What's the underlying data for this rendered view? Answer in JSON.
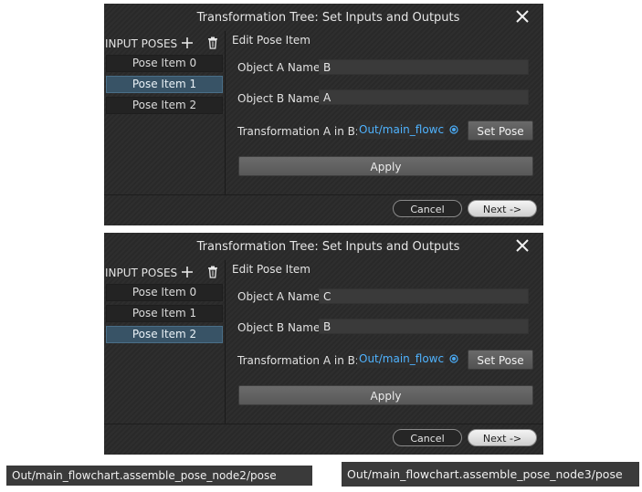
{
  "dialogs": [
    {
      "title": "Transformation Tree: Set Inputs and Outputs",
      "panel_label": "INPUT POSES",
      "pose_items": [
        {
          "label": "Pose Item 0",
          "selected": false
        },
        {
          "label": "Pose Item 1",
          "selected": true
        },
        {
          "label": "Pose Item 2",
          "selected": false
        }
      ],
      "editor_title": "Edit Pose Item",
      "object_a_label": "Object A Name:",
      "object_a_value": "B",
      "object_b_label": "Object B Name:",
      "object_b_value": "A",
      "transform_label": "Transformation A in B:",
      "transform_value": "Out/main_flowchart.assemble_pose_node2/pose",
      "set_pose_label": "Set Pose",
      "apply_label": "Apply",
      "cancel_label": "Cancel",
      "next_label": "Next ->"
    },
    {
      "title": "Transformation Tree: Set Inputs and Outputs",
      "panel_label": "INPUT POSES",
      "pose_items": [
        {
          "label": "Pose Item 0",
          "selected": false
        },
        {
          "label": "Pose Item 1",
          "selected": false
        },
        {
          "label": "Pose Item 2",
          "selected": true
        }
      ],
      "editor_title": "Edit Pose Item",
      "object_a_label": "Object A Name:",
      "object_a_value": "C",
      "object_b_label": "Object B Name:",
      "object_b_value": "B",
      "transform_label": "Transformation A in B:",
      "transform_value": "Out/main_flowchart.assemble_pose_node3/pose",
      "set_pose_label": "Set Pose",
      "apply_label": "Apply",
      "cancel_label": "Cancel",
      "next_label": "Next ->"
    }
  ],
  "tooltips": [
    "Out/main_flowchart.assemble_pose_node2/pose",
    "Out/main_flowchart.assemble_pose_node3/pose"
  ],
  "colors": {
    "selected_item": "#385366",
    "link_text": "#4fb3ff",
    "radio": "#4aa8f0"
  },
  "icons": {
    "close": "close-icon",
    "add": "plus-icon",
    "delete": "trash-icon",
    "radio": "radio-selected-icon"
  }
}
